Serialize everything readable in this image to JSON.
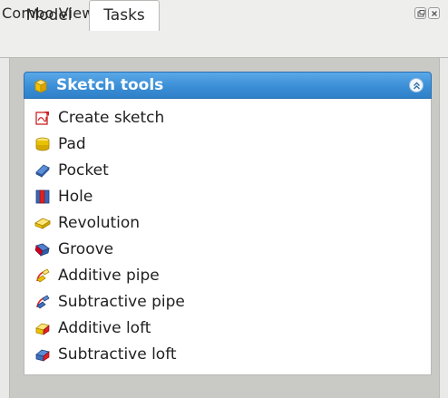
{
  "window": {
    "title": "Combo View"
  },
  "tabs": [
    {
      "label": "Model",
      "active": false
    },
    {
      "label": "Tasks",
      "active": true
    }
  ],
  "taskbox": {
    "title": "Sketch tools",
    "header_color": "#3b8fd6",
    "collapse_icon": "double-chevron-up-icon",
    "commands": [
      {
        "label": "Create sketch",
        "icon": "create-sketch-icon"
      },
      {
        "label": "Pad",
        "icon": "pad-icon"
      },
      {
        "label": "Pocket",
        "icon": "pocket-icon"
      },
      {
        "label": "Hole",
        "icon": "hole-icon"
      },
      {
        "label": "Revolution",
        "icon": "revolution-icon"
      },
      {
        "label": "Groove",
        "icon": "groove-icon"
      },
      {
        "label": "Additive pipe",
        "icon": "additive-pipe-icon"
      },
      {
        "label": "Subtractive pipe",
        "icon": "subtractive-pipe-icon"
      },
      {
        "label": "Additive loft",
        "icon": "additive-loft-icon"
      },
      {
        "label": "Subtractive loft",
        "icon": "subtractive-loft-icon"
      }
    ]
  }
}
